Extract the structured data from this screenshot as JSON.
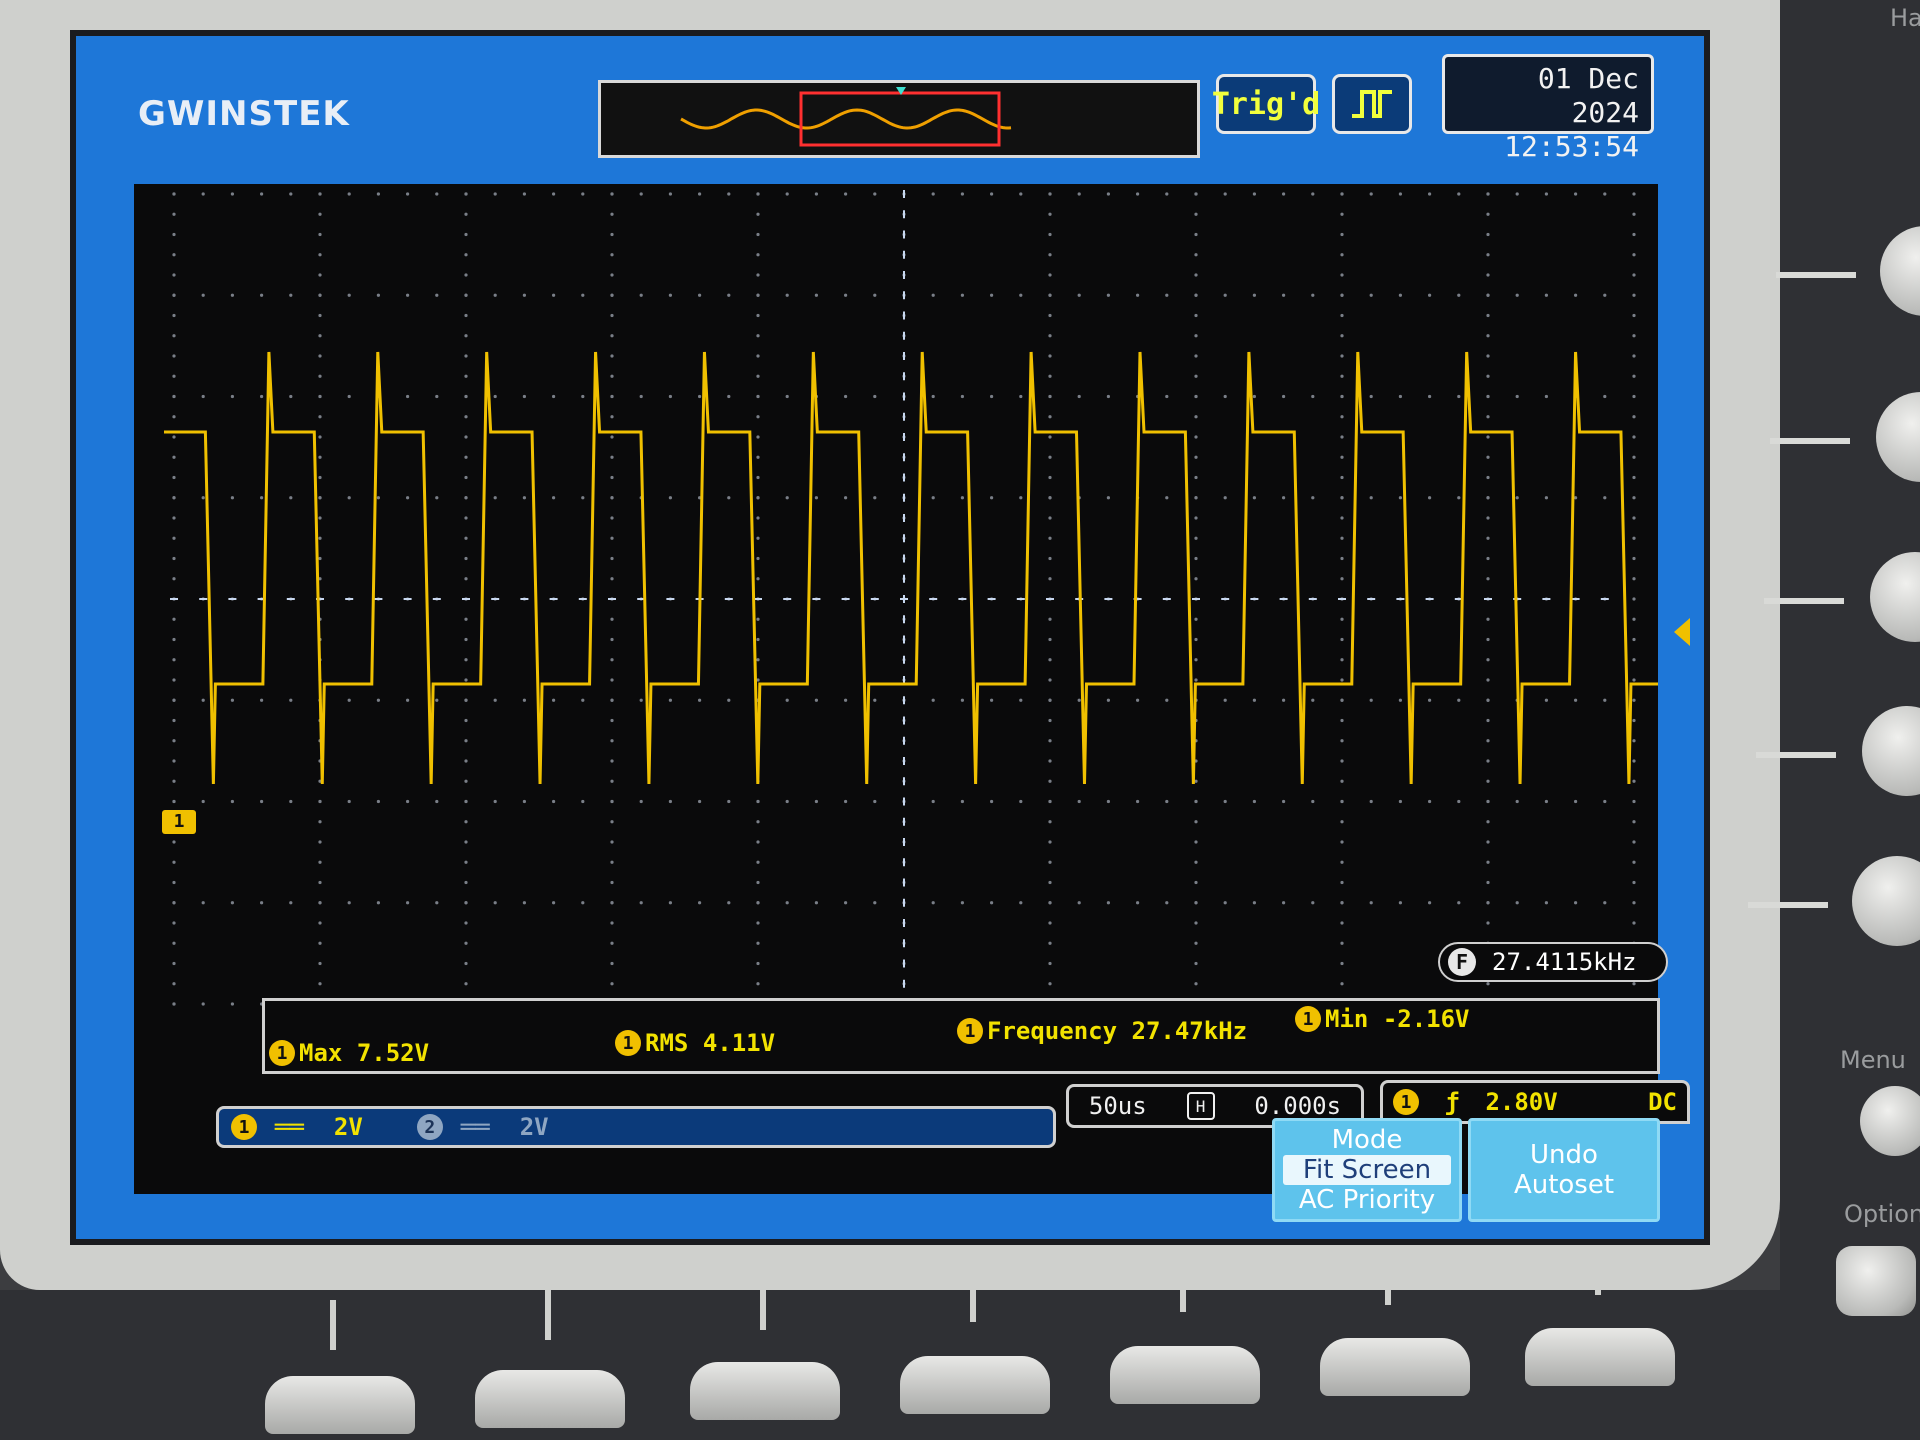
{
  "brand": "GWINSTEK",
  "status": {
    "trigger_state": "Trig'd"
  },
  "datetime": {
    "date": "01 Dec 2024",
    "time": "12:53:54"
  },
  "frequency_counter": {
    "icon_label": "F",
    "value": "27.4115kHz"
  },
  "measurements": [
    {
      "channel": "1",
      "label": "Max",
      "value": "7.52V"
    },
    {
      "channel": "1",
      "label": "RMS",
      "value": "4.11V"
    },
    {
      "channel": "1",
      "label": "Frequency",
      "value": "27.47kHz"
    },
    {
      "channel": "1",
      "label": "Min",
      "value": "-2.16V"
    }
  ],
  "horizontal": {
    "timebase": "50us",
    "icon_label": "H",
    "position": "0.000s"
  },
  "trigger": {
    "channel": "1",
    "slope_symbol": "ƒ",
    "level": "2.80V",
    "coupling": "DC"
  },
  "channels": [
    {
      "number": "1",
      "coupling_symbol": "══",
      "scale": "2V",
      "active": true,
      "color": "#f2e200"
    },
    {
      "number": "2",
      "coupling_symbol": "══",
      "scale": "2V",
      "active": false,
      "color": "#8fa6c2"
    }
  ],
  "ch1_marker": "1",
  "softkeys": [
    {
      "title": "Mode",
      "options": [
        "Fit Screen",
        "AC Priority"
      ],
      "selected": "Fit Screen"
    },
    {
      "title": "Undo",
      "subtitle": "Autoset"
    }
  ],
  "side_labels": {
    "menu": "Menu",
    "option": "Option",
    "corner": "Ha"
  },
  "colors": {
    "screen_bg": "#1e77d8",
    "trace": "#f0c000",
    "grid_bg": "#0a0a0b",
    "softkey": "#5ec3ec"
  },
  "chart_data": {
    "type": "line",
    "signal_shape": "square-wave",
    "cycles_on_screen": 13.5,
    "high_level_v": 7.52,
    "low_level_v": -2.16,
    "frequency_khz": 27.47,
    "volts_per_div": 2,
    "time_per_div_us": 50
  }
}
